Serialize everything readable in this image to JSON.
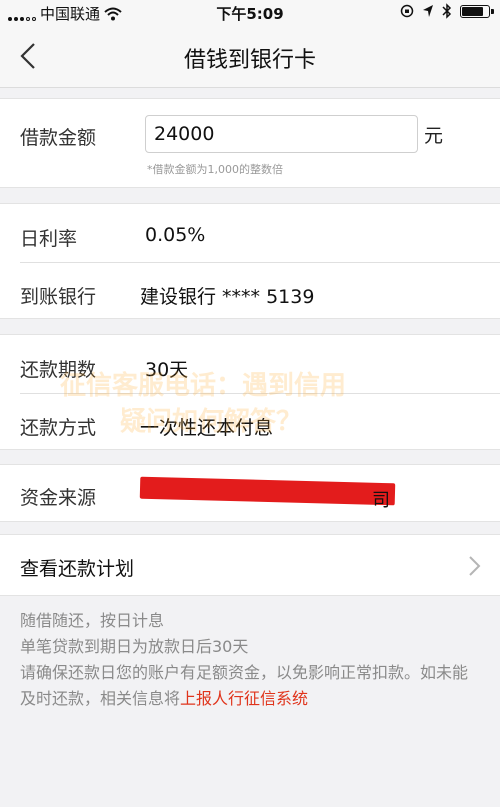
{
  "status_bar": {
    "carrier": "中国联通",
    "time": "下午5:09",
    "battery_percent": 85
  },
  "nav": {
    "title": "借钱到银行卡"
  },
  "loan": {
    "amount_label": "借款金额",
    "amount_value": "24000",
    "amount_unit": "元",
    "amount_hint": "*借款金额为1,000的整数倍"
  },
  "details": {
    "rate_label": "日利率",
    "rate_value": "0.05%",
    "bank_label": "到账银行",
    "bank_value": "建设银行 **** 5139"
  },
  "repayment": {
    "term_label": "还款期数",
    "term_value": "30天",
    "method_label": "还款方式",
    "method_value": "一次性还本付息"
  },
  "funding": {
    "source_label": "资金来源",
    "source_visible_tail": "司"
  },
  "watermark": {
    "line1": "征信客服电话：遇到信用",
    "line2": "疑问如何解答？"
  },
  "plan": {
    "label": "查看还款计划"
  },
  "notes": {
    "line1": "随借随还，按日计息",
    "line2": "单笔贷款到期日为放款日后30天",
    "line3": "请确保还款日您的账户有足额资金，以免影响正常扣款。如未能及时还款，相关信息将",
    "line3_warn": "上报人行征信系统"
  },
  "colors": {
    "warning": "#e0341b",
    "redaction": "#e31c1c",
    "background": "#f2f2f4"
  }
}
